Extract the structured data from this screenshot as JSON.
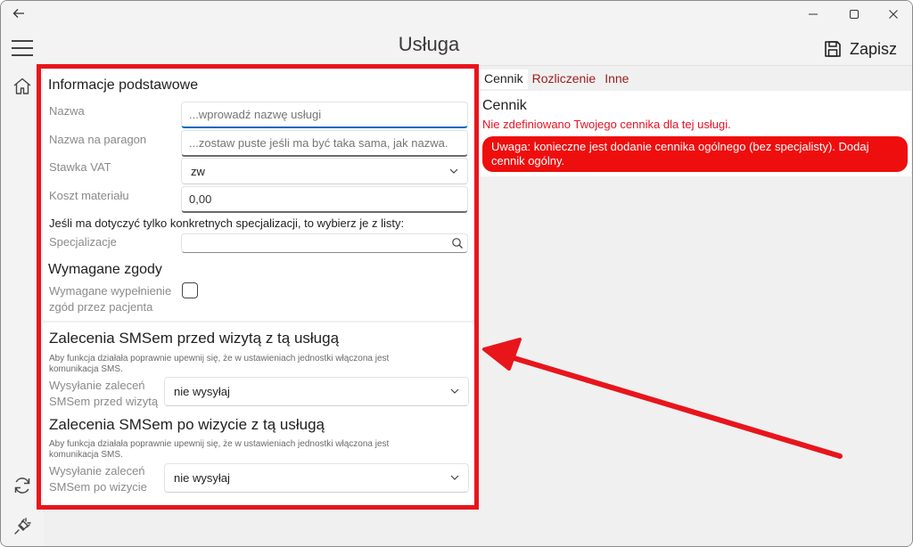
{
  "window": {
    "title": "Usługa"
  },
  "titlebar": {
    "minimize": "—",
    "maximize": "☐",
    "close": "✕"
  },
  "toolbar": {
    "save_label": "Zapisz"
  },
  "basic": {
    "title": "Informacje podstawowe",
    "name_label": "Nazwa",
    "name_placeholder": "...wprowadź nazwę usługi",
    "receipt_label": "Nazwa na paragon",
    "receipt_placeholder": "...zostaw puste jeśli ma być taka sama, jak nazwa.",
    "vat_label": "Stawka VAT",
    "vat_value": "zw",
    "material_label": "Koszt materiału",
    "material_value": "0,00",
    "spec_hint": "Jeśli ma dotyczyć tylko konkretnych specjalizacji, to wybierz je z listy:",
    "spec_label": "Specjalizacje"
  },
  "consents": {
    "title": "Wymagane zgody",
    "checkbox_label_line1": "Wymagane wypełnienie",
    "checkbox_label_line2": "zgód przez pacjenta"
  },
  "sms_before": {
    "title": "Zalecenia SMSem przed wizytą z tą usługą",
    "note_line1": "Aby funkcja działała poprawnie upewnij się, że w ustawieniach jednostki włączona jest",
    "note_line2": "komunikacja SMS.",
    "label_line1": "Wysyłanie zaleceń",
    "label_line2": "SMSem przed wizytą",
    "value": "nie wysyłaj"
  },
  "sms_after": {
    "title": "Zalecenia SMSem po wizycie z tą usługą",
    "note_line1": "Aby funkcja działała poprawnie upewnij się, że w ustawieniach jednostki włączona jest",
    "note_line2": "komunikacja SMS.",
    "label_line1": "Wysyłanie zaleceń",
    "label_line2": "SMSem po wizycie",
    "value": "nie wysyłaj"
  },
  "tabs": [
    {
      "label": "Cennik"
    },
    {
      "label": "Rozliczenie"
    },
    {
      "label": "Inne"
    }
  ],
  "pricelist": {
    "title": "Cennik",
    "warning": "Nie zdefiniowano Twojego cennika dla tej usługi.",
    "alert": "Uwaga: konieczne jest dodanie cennika ogólnego (bez specjalisty). Dodaj cennik ogólny."
  },
  "colors": {
    "annotation_red": "#e8151b",
    "warning_red": "#e81123",
    "accent_blue": "#0067c0"
  }
}
